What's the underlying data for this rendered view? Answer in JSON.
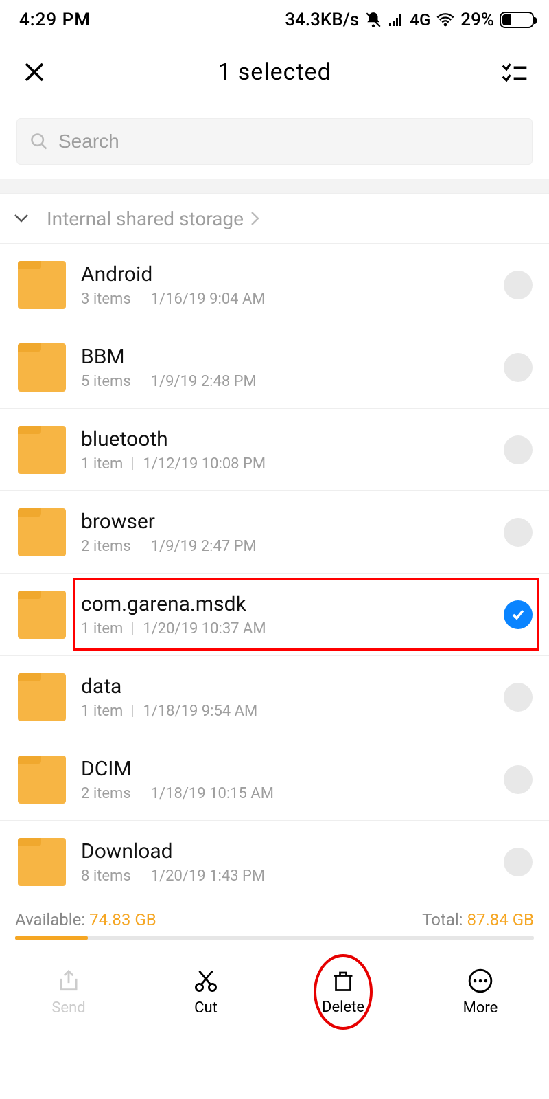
{
  "status": {
    "time": "4:29 PM",
    "net_speed": "34.3KB/s",
    "network_label": "4G",
    "battery_pct": "29%"
  },
  "header": {
    "title": "1 selected"
  },
  "search": {
    "placeholder": "Search"
  },
  "breadcrumb": {
    "path": "Internal shared storage"
  },
  "folders": [
    {
      "name": "Android",
      "items": "3 items",
      "date": "1/16/19 9:04 AM",
      "selected": false,
      "highlighted": false
    },
    {
      "name": "BBM",
      "items": "5 items",
      "date": "1/9/19 2:48 PM",
      "selected": false,
      "highlighted": false
    },
    {
      "name": "bluetooth",
      "items": "1 item",
      "date": "1/12/19 10:08 PM",
      "selected": false,
      "highlighted": false
    },
    {
      "name": "browser",
      "items": "2 items",
      "date": "1/9/19 2:47 PM",
      "selected": false,
      "highlighted": false
    },
    {
      "name": "com.garena.msdk",
      "items": "1 item",
      "date": "1/20/19 10:37 AM",
      "selected": true,
      "highlighted": true
    },
    {
      "name": "data",
      "items": "1 item",
      "date": "1/18/19 9:54 AM",
      "selected": false,
      "highlighted": false
    },
    {
      "name": "DCIM",
      "items": "2 items",
      "date": "1/18/19 10:15 AM",
      "selected": false,
      "highlighted": false
    },
    {
      "name": "Download",
      "items": "8 items",
      "date": "1/20/19 1:43 PM",
      "selected": false,
      "highlighted": false
    }
  ],
  "storage": {
    "available_label": "Available: ",
    "available_value": "74.83 GB",
    "total_label": "Total: ",
    "total_value": "87.84 GB"
  },
  "bottom": {
    "send": "Send",
    "cut": "Cut",
    "delete": "Delete",
    "more": "More"
  }
}
